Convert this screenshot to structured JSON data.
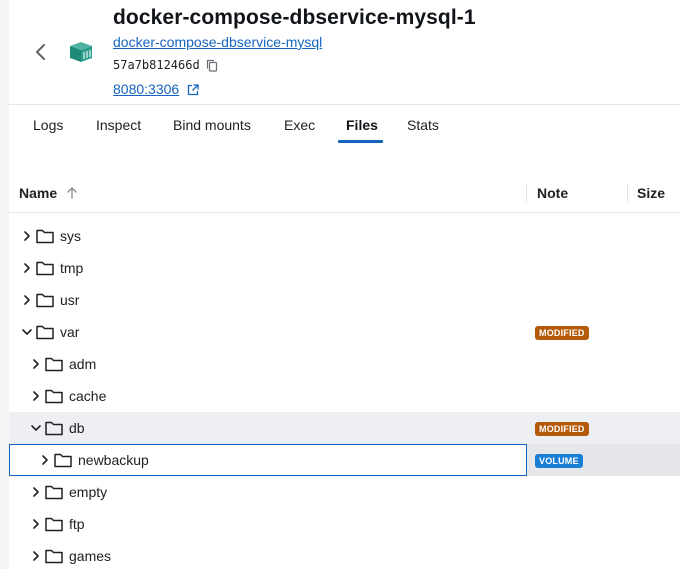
{
  "container": {
    "name": "docker-compose-dbservice-mysql-1",
    "image": "docker-compose-dbservice-mysql",
    "id": "57a7b812466d",
    "port": "8080:3306"
  },
  "tabs": [
    {
      "label": "Logs",
      "active": false
    },
    {
      "label": "Inspect",
      "active": false
    },
    {
      "label": "Bind mounts",
      "active": false
    },
    {
      "label": "Exec",
      "active": false
    },
    {
      "label": "Files",
      "active": true
    },
    {
      "label": "Stats",
      "active": false
    }
  ],
  "table": {
    "columns": {
      "name": "Name",
      "note": "Note",
      "size": "Size"
    },
    "sort": "ascending",
    "rows": [
      {
        "name": "",
        "depth": 0,
        "expanded": false,
        "note": ""
      },
      {
        "name": "sys",
        "depth": 0,
        "expanded": false,
        "note": ""
      },
      {
        "name": "tmp",
        "depth": 0,
        "expanded": false,
        "note": ""
      },
      {
        "name": "usr",
        "depth": 0,
        "expanded": false,
        "note": ""
      },
      {
        "name": "var",
        "depth": 0,
        "expanded": true,
        "note": "MODIFIED"
      },
      {
        "name": "adm",
        "depth": 1,
        "expanded": false,
        "note": ""
      },
      {
        "name": "cache",
        "depth": 1,
        "expanded": false,
        "note": ""
      },
      {
        "name": "db",
        "depth": 1,
        "expanded": true,
        "note": "MODIFIED"
      },
      {
        "name": "newbackup",
        "depth": 2,
        "expanded": false,
        "note": "VOLUME",
        "selected": true
      },
      {
        "name": "empty",
        "depth": 1,
        "expanded": false,
        "note": ""
      },
      {
        "name": "ftp",
        "depth": 1,
        "expanded": false,
        "note": ""
      },
      {
        "name": "games",
        "depth": 1,
        "expanded": false,
        "note": ""
      }
    ]
  },
  "colors": {
    "accent": "#1565c0",
    "badge_modified": "#b45a09",
    "badge_volume": "#1a7fd4"
  },
  "icons": {
    "back": "chevron-left-icon",
    "container": "container-icon",
    "copy": "copy-icon",
    "external": "external-link-icon",
    "sort": "arrow-up-icon",
    "folder": "folder-icon"
  }
}
